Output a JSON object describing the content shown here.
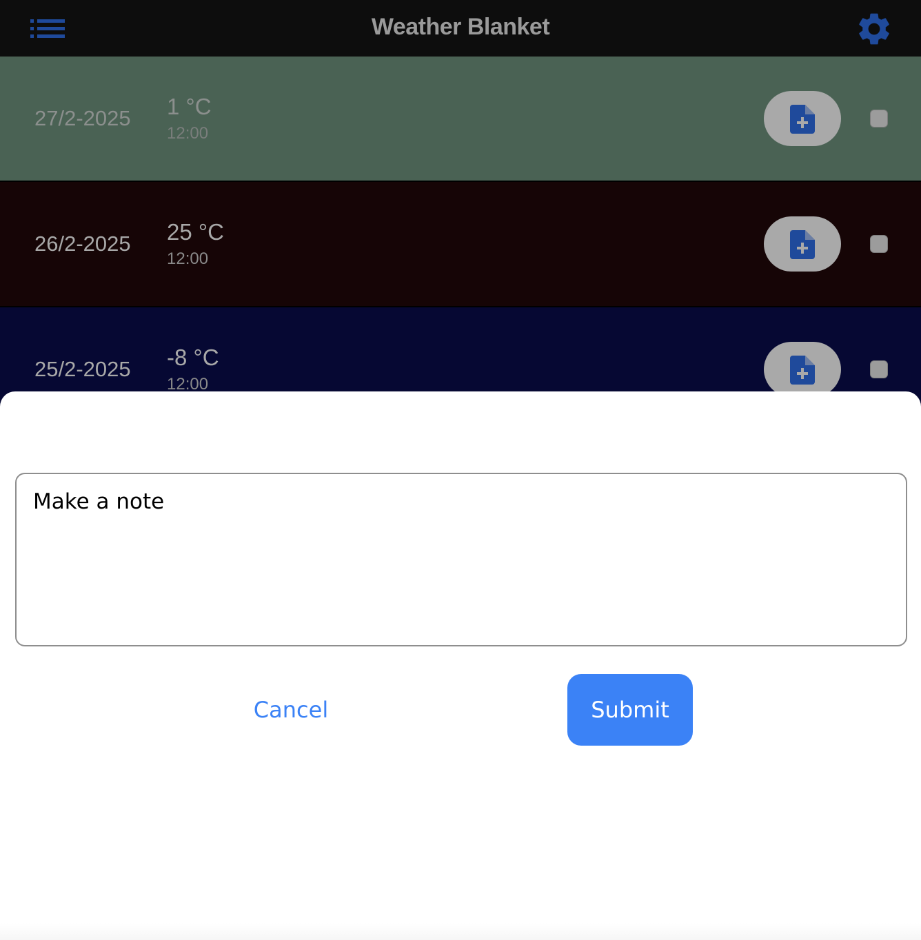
{
  "header": {
    "title": "Weather Blanket",
    "menu_icon": "list-icon",
    "settings_icon": "gear-icon",
    "icon_color": "#1f4a9b",
    "background": "#0d0d0d"
  },
  "entries": [
    {
      "date": "27/2-2025",
      "temperature": "1 °C",
      "time": "12:00",
      "color": "#4a6254",
      "checked": false
    },
    {
      "date": "26/2-2025",
      "temperature": "25 °C",
      "time": "12:00",
      "color": "#160506",
      "checked": false
    },
    {
      "date": "25/2-2025",
      "temperature": "-8 °C",
      "time": "12:00",
      "color": "#060833",
      "checked": false
    }
  ],
  "note_dialog": {
    "placeholder": "Make a note",
    "value": "",
    "cancel_label": "Cancel",
    "submit_label": "Submit",
    "accent_color": "#3b82f6"
  }
}
